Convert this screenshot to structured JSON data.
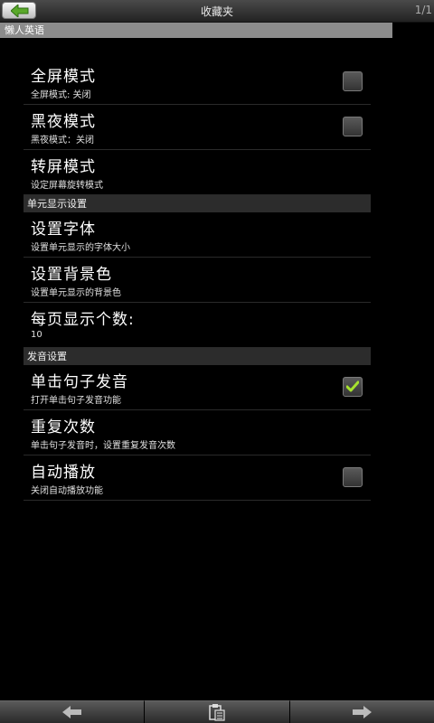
{
  "header": {
    "title": "收藏夹",
    "page_counter": "1/1"
  },
  "subheader": {
    "app_name": "懒人英语"
  },
  "settings": {
    "fullscreen": {
      "title": "全屏模式",
      "summary": "全屏模式: 关闭",
      "checked": false
    },
    "night": {
      "title": "黑夜模式",
      "summary": "黑夜模式：关闭",
      "checked": false
    },
    "rotate": {
      "title": "转屏模式",
      "summary": "设定屏幕旋转模式"
    },
    "section_display": "单元显示设置",
    "font": {
      "title": "设置字体",
      "summary": "设置单元显示的字体大小"
    },
    "background": {
      "title": "设置背景色",
      "summary": "设置单元显示的背景色"
    },
    "per_page": {
      "title": "每页显示个数:",
      "summary": "10"
    },
    "section_audio": "发音设置",
    "click_speak": {
      "title": "单击句子发音",
      "summary": "打开单击句子发音功能",
      "checked": true
    },
    "repeat": {
      "title": "重复次数",
      "summary": "单击句子发音时，设置重复发音次数"
    },
    "autoplay": {
      "title": "自动播放",
      "summary": "关闭自动播放功能",
      "checked": false
    }
  },
  "colors": {
    "accent_green": "#9acd32",
    "check_green": "#a6e22e"
  },
  "icons": {
    "back": "back-arrow-icon",
    "prev": "arrow-left-icon",
    "middle": "clipboard-icon",
    "next": "arrow-right-icon"
  }
}
